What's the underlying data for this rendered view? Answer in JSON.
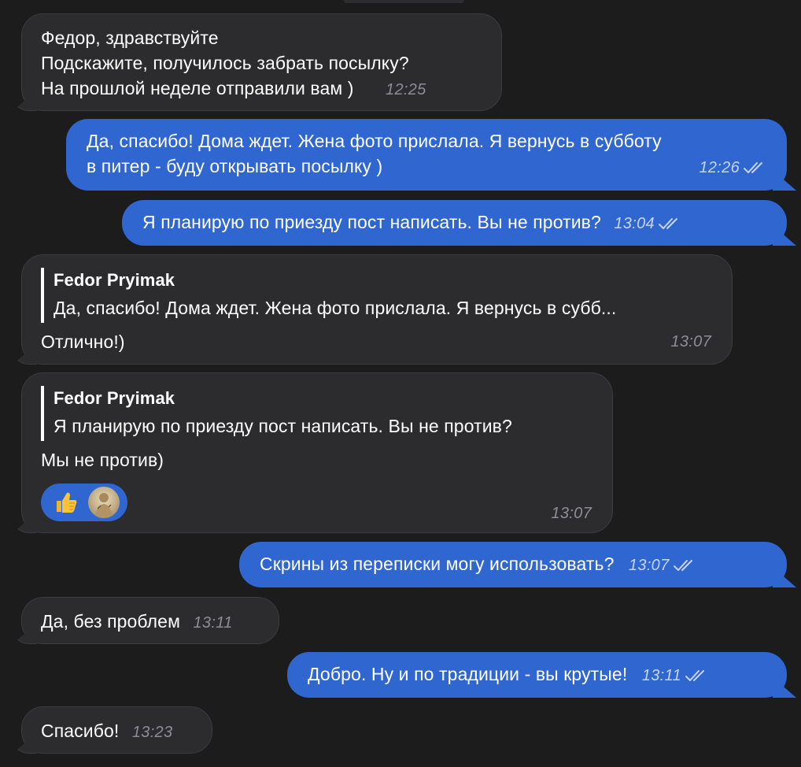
{
  "colors": {
    "background": "#1c1c1d",
    "incoming": "#2c2c2e",
    "outgoing": "#2f66d0",
    "reaction": "#2f66d0"
  },
  "messages": [
    {
      "direction": "in",
      "lines": [
        "Федор, здравствуйте",
        "Подскажите, получилось забрать посылку?",
        "На прошлой неделе отправили вам )"
      ],
      "time": "12:25"
    },
    {
      "direction": "out",
      "lines": [
        "Да, спасибо! Дома ждет. Жена фото прислала. Я вернусь в субботу",
        "в питер - буду открывать посылку )"
      ],
      "time": "12:26",
      "status": "read"
    },
    {
      "direction": "out",
      "lines": [
        "Я планирую по приезду пост написать. Вы не против?"
      ],
      "time": "13:04",
      "status": "read"
    },
    {
      "direction": "in",
      "reply": {
        "author": "Fedor Pryimak",
        "text": "Да, спасибо! Дома ждет. Жена фото прислала. Я вернусь в субб..."
      },
      "lines": [
        "Отлично!)"
      ],
      "time": "13:07"
    },
    {
      "direction": "in",
      "reply": {
        "author": "Fedor Pryimak",
        "text": "Я планирую по приезду пост написать. Вы не против?"
      },
      "lines": [
        "Мы не против)"
      ],
      "time": "13:07",
      "reactions": [
        {
          "icon": "thumbs-up-icon"
        },
        {
          "icon": "avatar"
        }
      ]
    },
    {
      "direction": "out",
      "lines": [
        "Скрины из переписки могу использовать?"
      ],
      "time": "13:07",
      "status": "read"
    },
    {
      "direction": "in",
      "lines": [
        "Да, без проблем"
      ],
      "time": "13:11"
    },
    {
      "direction": "out",
      "lines": [
        "Добро. Ну и по традиции - вы крутые!"
      ],
      "time": "13:11",
      "status": "read"
    },
    {
      "direction": "in",
      "lines": [
        "Спасибо!"
      ],
      "time": "13:23"
    }
  ]
}
